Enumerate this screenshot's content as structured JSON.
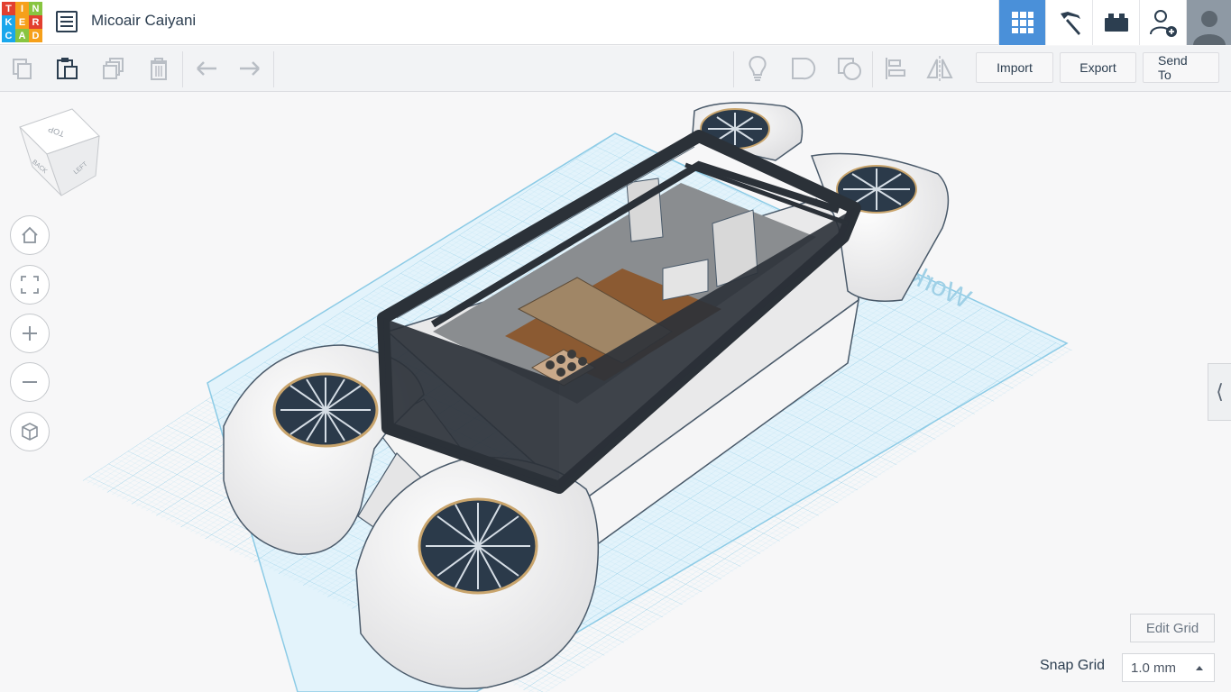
{
  "app": {
    "logo_letters": [
      "T",
      "I",
      "N",
      "K",
      "E",
      "R",
      "C",
      "A",
      "D"
    ],
    "logo_colors": [
      "#e2402f",
      "#f6a01a",
      "#88c540",
      "#1aa7ec",
      "#f6a01a",
      "#e2402f",
      "#1aa7ec",
      "#88c540",
      "#f6a01a"
    ],
    "design_title": "Micoair Caiyani"
  },
  "header_icons": [
    "grid-view-icon",
    "pickaxe-icon",
    "brick-icon",
    "add-user-icon",
    "avatar"
  ],
  "toolbar": {
    "left_tools": [
      "copy-icon",
      "paste-icon",
      "duplicate-icon",
      "trash-icon",
      "undo-icon",
      "redo-icon"
    ],
    "right_tools": [
      "lightbulb-icon",
      "group-icon",
      "ungroup-icon",
      "align-icon",
      "mirror-icon"
    ],
    "import_label": "Import",
    "export_label": "Export",
    "send_to_label": "Send To"
  },
  "view_cube": {
    "top": "TOP",
    "back": "BACK",
    "left": "LEFT"
  },
  "nav_controls": [
    "home-icon",
    "fit-view-icon",
    "zoom-in-icon",
    "zoom-out-icon",
    "perspective-icon"
  ],
  "workplane": {
    "label": "Workplane",
    "grid_color": "#a8d8ef"
  },
  "footer": {
    "edit_grid_label": "Edit Grid",
    "snap_grid_label": "Snap Grid",
    "snap_grid_value": "1.0 mm"
  },
  "colors": {
    "accent": "#4a90d9",
    "body_white": "#f2f2f2",
    "frame_dark": "#2b3138",
    "wood": "#8b5a32"
  }
}
